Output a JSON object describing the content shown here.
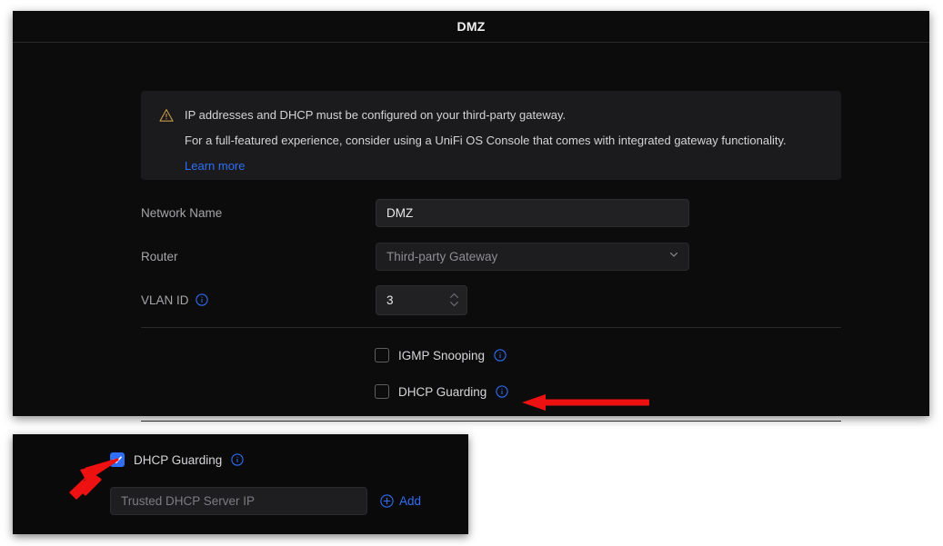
{
  "panel": {
    "title": "DMZ"
  },
  "warning": {
    "icon": "warning-triangle-icon",
    "line1": "IP addresses and DHCP must be configured on your third-party gateway.",
    "line2": "For a full-featured experience, consider using a UniFi OS Console that comes with integrated gateway functionality.",
    "link_label": "Learn more",
    "link_color": "#2f6ef5",
    "icon_color": "#c89a4a",
    "background": "#1b1b1d"
  },
  "form": {
    "network_name": {
      "label": "Network Name",
      "value": "DMZ",
      "placeholder": ""
    },
    "router": {
      "label": "Router",
      "value": "Third-party Gateway",
      "options": [
        "Third-party Gateway"
      ],
      "chevron": "chevron-down-icon"
    },
    "vlan_id": {
      "label": "VLAN ID",
      "value": "3",
      "info": "info-icon"
    }
  },
  "options": [
    {
      "name": "igmp-snooping",
      "label": "IGMP Snooping",
      "checked": false,
      "info": "info-icon"
    },
    {
      "name": "dhcp-guarding",
      "label": "DHCP Guarding",
      "checked": false,
      "info": "info-icon"
    }
  ],
  "inset": {
    "checkbox": {
      "label": "DHCP Guarding",
      "checked": true,
      "checked_color": "#2f6ef5",
      "info": "info-icon"
    },
    "trusted_ip": {
      "value": "",
      "placeholder": "Trusted DHCP Server IP"
    },
    "add_button": {
      "label": "Add",
      "icon": "plus-circle-icon",
      "color": "#2f6ef5"
    }
  },
  "annotations": {
    "arrow_color": "#ee1111",
    "main_arrow": "left-pointing-arrow",
    "inset_arrow": "cursor-pointer-arrow"
  }
}
